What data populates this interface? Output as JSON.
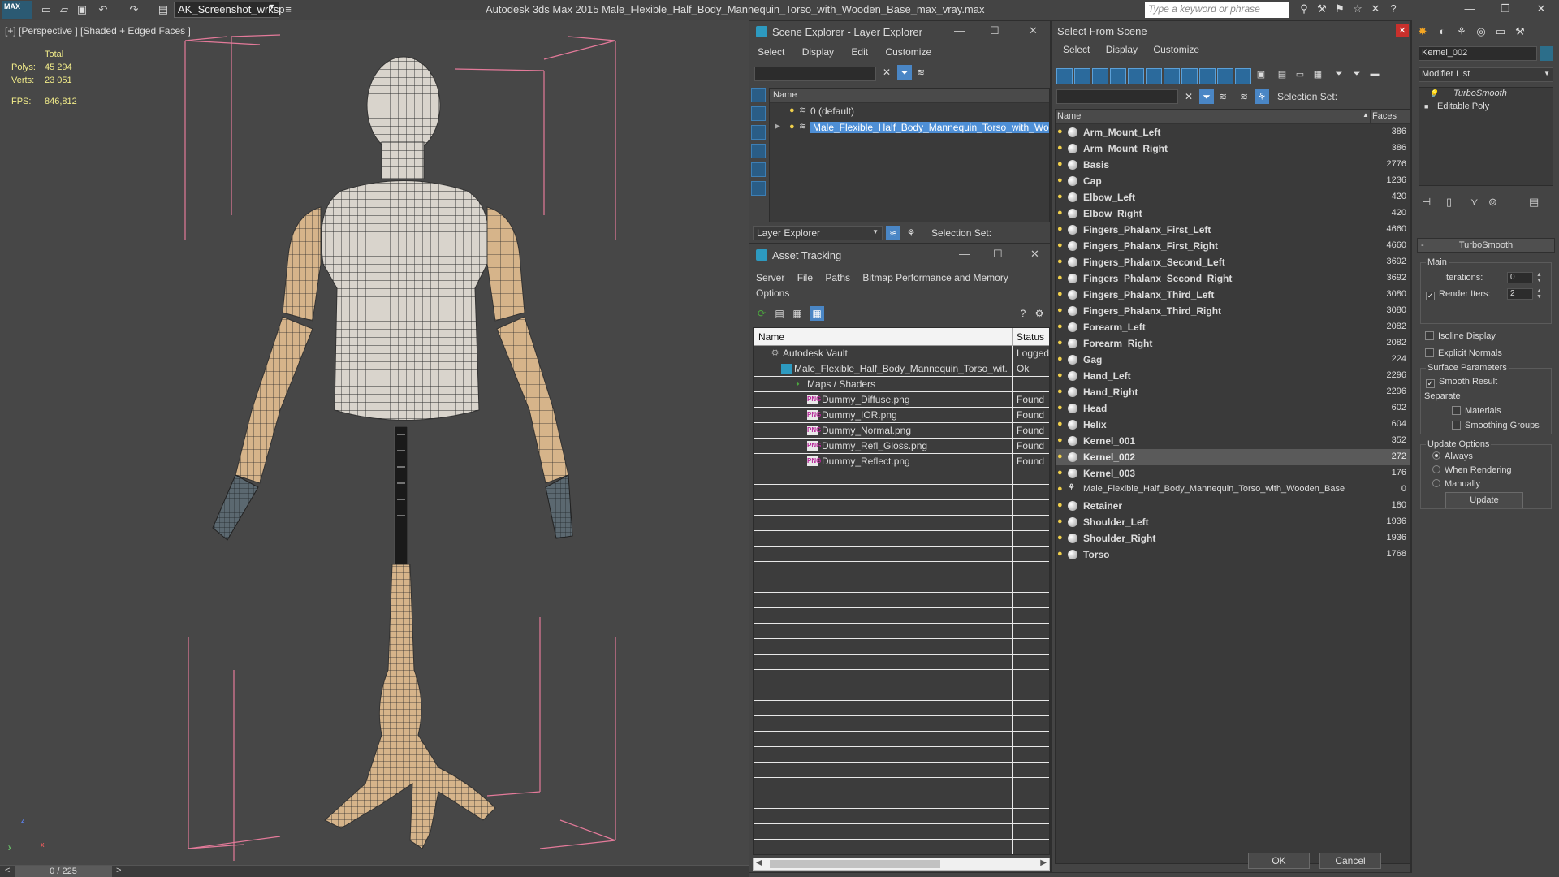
{
  "app": {
    "logo": "MAX",
    "title": "Autodesk 3ds Max  2015    Male_Flexible_Half_Body_Mannequin_Torso_with_Wooden_Base_max_vray.max",
    "workspace": "AK_Screenshot_wrksp",
    "search_placeholder": "Type a keyword or phrase"
  },
  "viewport": {
    "label": "[+] [Perspective ] [Shaded + Edged Faces ]",
    "stats": {
      "total_label": "Total",
      "polys_label": "Polys:",
      "polys": "45 294",
      "verts_label": "Verts:",
      "verts": "23 051",
      "fps_label": "FPS:",
      "fps": "846,812"
    },
    "axis": {
      "z": "z",
      "x": "x",
      "y": "y"
    }
  },
  "timeline": {
    "prev": "<",
    "frame": "0 / 225",
    "next": ">"
  },
  "scene_explorer": {
    "title": "Scene Explorer - Layer Explorer",
    "menu": [
      "Select",
      "Display",
      "Edit",
      "Customize"
    ],
    "column": "Name",
    "rows": [
      {
        "name": "0 (default)",
        "selected": false
      },
      {
        "name": "Male_Flexible_Half_Body_Mannequin_Torso_with_Woode...",
        "selected": true
      }
    ],
    "footer_dropdown": "Layer Explorer",
    "selection_set_label": "Selection Set:"
  },
  "asset_tracking": {
    "title": "Asset Tracking",
    "menu": [
      "Server",
      "File",
      "Paths",
      "Bitmap Performance and Memory",
      "Options"
    ],
    "columns": {
      "name": "Name",
      "status": "Status"
    },
    "rows": [
      {
        "name": "Autodesk Vault",
        "status": "Logged",
        "indent": 1,
        "icon": "vault"
      },
      {
        "name": "Male_Flexible_Half_Body_Mannequin_Torso_wit...",
        "status": "Ok",
        "indent": 2,
        "icon": "file"
      },
      {
        "name": "Maps / Shaders",
        "status": "",
        "indent": 3,
        "icon": "maps"
      },
      {
        "name": "Dummy_Diffuse.png",
        "status": "Found",
        "indent": 4,
        "icon": "png"
      },
      {
        "name": "Dummy_IOR.png",
        "status": "Found",
        "indent": 4,
        "icon": "png"
      },
      {
        "name": "Dummy_Normal.png",
        "status": "Found",
        "indent": 4,
        "icon": "png"
      },
      {
        "name": "Dummy_Refl_Gloss.png",
        "status": "Found",
        "indent": 4,
        "icon": "png"
      },
      {
        "name": "Dummy_Reflect.png",
        "status": "Found",
        "indent": 4,
        "icon": "png"
      }
    ],
    "png_badge": "PNG"
  },
  "select_from_scene": {
    "title": "Select From Scene",
    "menu": [
      "Select",
      "Display",
      "Customize"
    ],
    "selection_set_label": "Selection Set:",
    "columns": {
      "name": "Name",
      "faces": "Faces"
    },
    "objects": [
      {
        "name": "Arm_Mount_Left",
        "faces": "386"
      },
      {
        "name": "Arm_Mount_Right",
        "faces": "386"
      },
      {
        "name": "Basis",
        "faces": "2776"
      },
      {
        "name": "Cap",
        "faces": "1236"
      },
      {
        "name": "Elbow_Left",
        "faces": "420"
      },
      {
        "name": "Elbow_Right",
        "faces": "420"
      },
      {
        "name": "Fingers_Phalanx_First_Left",
        "faces": "4660"
      },
      {
        "name": "Fingers_Phalanx_First_Right",
        "faces": "4660"
      },
      {
        "name": "Fingers_Phalanx_Second_Left",
        "faces": "3692"
      },
      {
        "name": "Fingers_Phalanx_Second_Right",
        "faces": "3692"
      },
      {
        "name": "Fingers_Phalanx_Third_Left",
        "faces": "3080"
      },
      {
        "name": "Fingers_Phalanx_Third_Right",
        "faces": "3080"
      },
      {
        "name": "Forearm_Left",
        "faces": "2082"
      },
      {
        "name": "Forearm_Right",
        "faces": "2082"
      },
      {
        "name": "Gag",
        "faces": "224"
      },
      {
        "name": "Hand_Left",
        "faces": "2296"
      },
      {
        "name": "Hand_Right",
        "faces": "2296"
      },
      {
        "name": "Head",
        "faces": "602"
      },
      {
        "name": "Helix",
        "faces": "604"
      },
      {
        "name": "Kernel_001",
        "faces": "352"
      },
      {
        "name": "Kernel_002",
        "faces": "272",
        "selected": true
      },
      {
        "name": "Kernel_003",
        "faces": "176"
      },
      {
        "name": "Male_Flexible_Half_Body_Mannequin_Torso_with_Wooden_Base",
        "faces": "0",
        "root": true
      },
      {
        "name": "Retainer",
        "faces": "180"
      },
      {
        "name": "Shoulder_Left",
        "faces": "1936"
      },
      {
        "name": "Shoulder_Right",
        "faces": "1936"
      },
      {
        "name": "Torso",
        "faces": "1768"
      }
    ],
    "ok": "OK",
    "cancel": "Cancel"
  },
  "command_panel": {
    "object_name": "Kernel_002",
    "modifier_list": "Modifier List",
    "stack": [
      "TurboSmooth",
      "Editable Poly"
    ],
    "rollout_title": "TurboSmooth",
    "main_label": "Main",
    "iterations_label": "Iterations:",
    "iterations": "0",
    "render_iters_label": "Render Iters:",
    "render_iters": "2",
    "isoline_display": "Isoline Display",
    "explicit_normals": "Explicit Normals",
    "surface_params_label": "Surface Parameters",
    "smooth_result": "Smooth Result",
    "separate_label": "Separate",
    "materials": "Materials",
    "smoothing_groups": "Smoothing Groups",
    "update_options_label": "Update Options",
    "always": "Always",
    "when_rendering": "When Rendering",
    "manually": "Manually",
    "update_button": "Update"
  }
}
